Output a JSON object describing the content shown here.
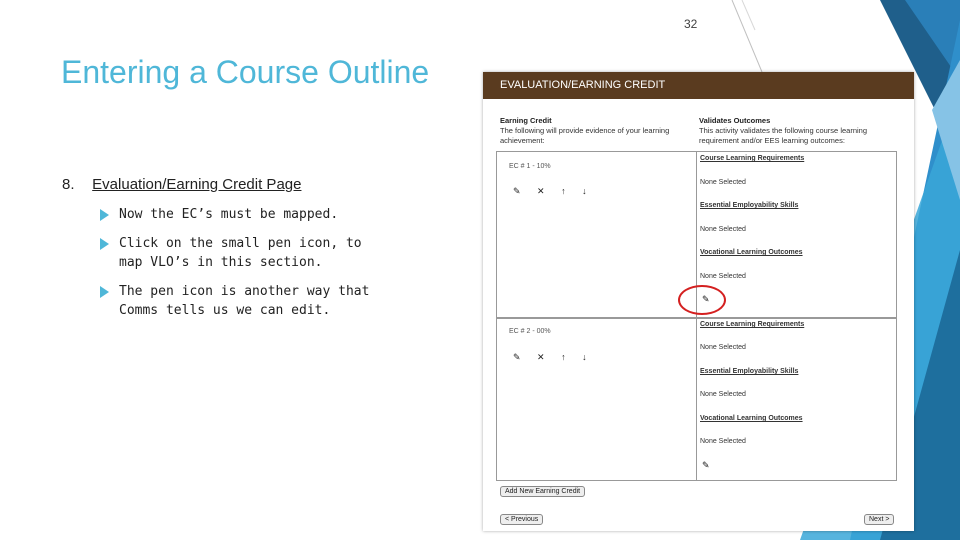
{
  "slide_number": "32",
  "title": "Entering a Course Outline",
  "section": {
    "number": "8.",
    "heading": "Evaluation/Earning Credit Page"
  },
  "bullets": [
    "Now the EC’s must be mapped.",
    "Click on the small pen icon, to map VLO’s in this section.",
    "The pen icon is another way that Comms tells us we can edit."
  ],
  "screenshot": {
    "header": "EVALUATION/EARNING CREDIT",
    "left_col": {
      "title": "Earning Credit",
      "desc": "The following will provide evidence of your learning achievement:"
    },
    "right_col": {
      "title": "Validates Outcomes",
      "desc": "This activity validates the following course learning requirement and/or EES learning outcomes:"
    },
    "ec1_label": "EC # 1 - 10%",
    "ec2_label": "EC # 2 - 00%",
    "icons": "✎ ✕ ↑ ↓",
    "course_learning_requirements": "Course Learning Requirements",
    "essential_employability_skills": "Essential Employability Skills",
    "vocational_learning_outcomes": "Vocational Learning Outcomes",
    "none_selected": "None Selected",
    "add_button": "Add New Earning Credit",
    "prev_button": "< Previous",
    "next_button": "Next >",
    "accent_color": "#d42020"
  }
}
